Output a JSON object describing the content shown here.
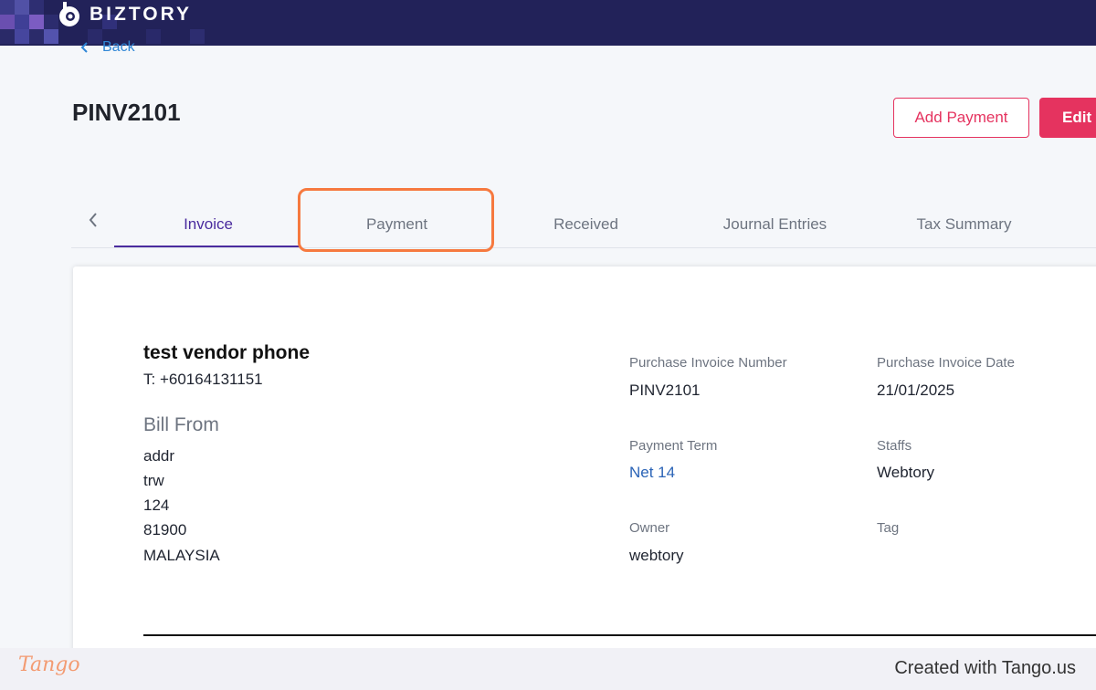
{
  "app": {
    "brand": "BIZTORY"
  },
  "nav": {
    "back_label": "Back"
  },
  "page": {
    "title": "PINV2101"
  },
  "actions": {
    "add_payment": "Add Payment",
    "edit": "Edit"
  },
  "tabs": [
    {
      "label": "Invoice",
      "active": true
    },
    {
      "label": "Payment",
      "active": false,
      "highlighted": true
    },
    {
      "label": "Received",
      "active": false
    },
    {
      "label": "Journal Entries",
      "active": false
    },
    {
      "label": "Tax Summary",
      "active": false
    }
  ],
  "vendor": {
    "name": "test vendor phone",
    "phone": "T: +60164131151",
    "bill_from_heading": "Bill From",
    "address": [
      "addr",
      "trw",
      "124",
      "81900",
      "MALAYSIA"
    ]
  },
  "details": {
    "purchase_invoice_number": {
      "label": "Purchase Invoice Number",
      "value": "PINV2101"
    },
    "purchase_invoice_date": {
      "label": "Purchase Invoice Date",
      "value": "21/01/2025"
    },
    "payment_term": {
      "label": "Payment Term",
      "value": "Net 14"
    },
    "staffs": {
      "label": "Staffs",
      "value": "Webtory"
    },
    "owner": {
      "label": "Owner",
      "value": "webtory"
    },
    "tag": {
      "label": "Tag",
      "value": ""
    }
  },
  "footer": {
    "tango_logo": "Tango",
    "created_with": "Created with Tango.us"
  },
  "colors": {
    "topbar": "#222259",
    "accent": "#e5335f",
    "tab_active": "#4a2b9e",
    "highlight": "#f6793f",
    "link": "#2a63b6"
  }
}
